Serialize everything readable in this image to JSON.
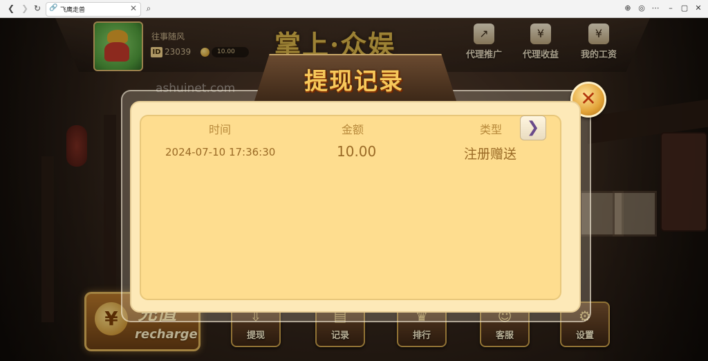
{
  "browser": {
    "tab_title": "飞鹰走兽",
    "tab_close": "✕",
    "back_icon": "back-arrow-icon",
    "forward_icon": "forward-arrow-icon",
    "reload_icon": "reload-icon"
  },
  "header": {
    "nickname": "往事随风",
    "id_label": "ID",
    "id_value": "23039",
    "coins": "10.00",
    "brand_title": "掌上·众娱",
    "actions": [
      {
        "label": "代理推广",
        "icon": "trend-chart-icon"
      },
      {
        "label": "代理收益",
        "icon": "money-bag-icon"
      },
      {
        "label": "我的工资",
        "icon": "salary-slip-icon"
      }
    ]
  },
  "watermark": "ashuinet.com",
  "dialog": {
    "title": "提现记录",
    "columns": [
      "时间",
      "金额",
      "类型"
    ],
    "rows": [
      {
        "time": "2024-07-10 17:36:30",
        "amount": "10.00",
        "type": "注册赠送"
      }
    ]
  },
  "bottom_bar": {
    "recharge_cn": "充值",
    "recharge_en": "recharge",
    "buttons": [
      {
        "label": "提现",
        "icon": "withdraw-icon"
      },
      {
        "label": "记录",
        "icon": "record-icon"
      },
      {
        "label": "排行",
        "icon": "crown-icon"
      },
      {
        "label": "客服",
        "icon": "support-icon"
      },
      {
        "label": "设置",
        "icon": "gear-icon"
      }
    ]
  },
  "colors": {
    "panel_bg": "#fedd8f",
    "title_gold": "#f7c85a",
    "text_brown": "#9a6a26"
  }
}
